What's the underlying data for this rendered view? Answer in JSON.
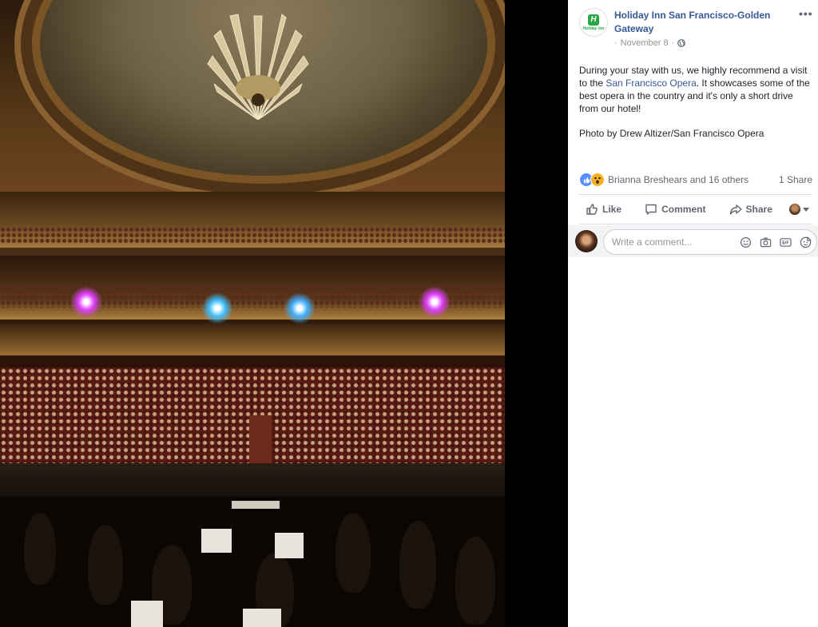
{
  "post": {
    "page_name": "Holiday Inn San Francisco-Golden Gateway",
    "logo": {
      "mark": "H",
      "text": "Holiday Inn"
    },
    "date": "November 8",
    "date_separator": "·",
    "audience_icon": "globe-icon",
    "more_label": "•••",
    "body_before_link": "During your stay with us, we highly recommend a visit to the ",
    "body_link": "San Francisco Opera",
    "body_after_link": ". It showcases some of the best opera in the country and it's only a short drive from our hotel!",
    "credit": "Photo by Drew Altizer/San Francisco Opera",
    "photo_icon": "opera-house-photo"
  },
  "reactions": {
    "icons": [
      "like-icon",
      "wow-icon"
    ],
    "summary": "Brianna Breshears and 16 others",
    "shares": "1 Share"
  },
  "actions": {
    "like": "Like",
    "comment": "Comment",
    "share": "Share"
  },
  "comment_box": {
    "placeholder": "Write a comment...",
    "icons": [
      "emoji-icon",
      "camera-icon",
      "gif-icon",
      "sticker-icon"
    ]
  },
  "colors": {
    "link": "#365899",
    "text": "#1d2129",
    "muted": "#90949c",
    "like_blue": "#5890ff",
    "wow_yellow": "#f7b125",
    "brand_green": "#2aa744"
  }
}
